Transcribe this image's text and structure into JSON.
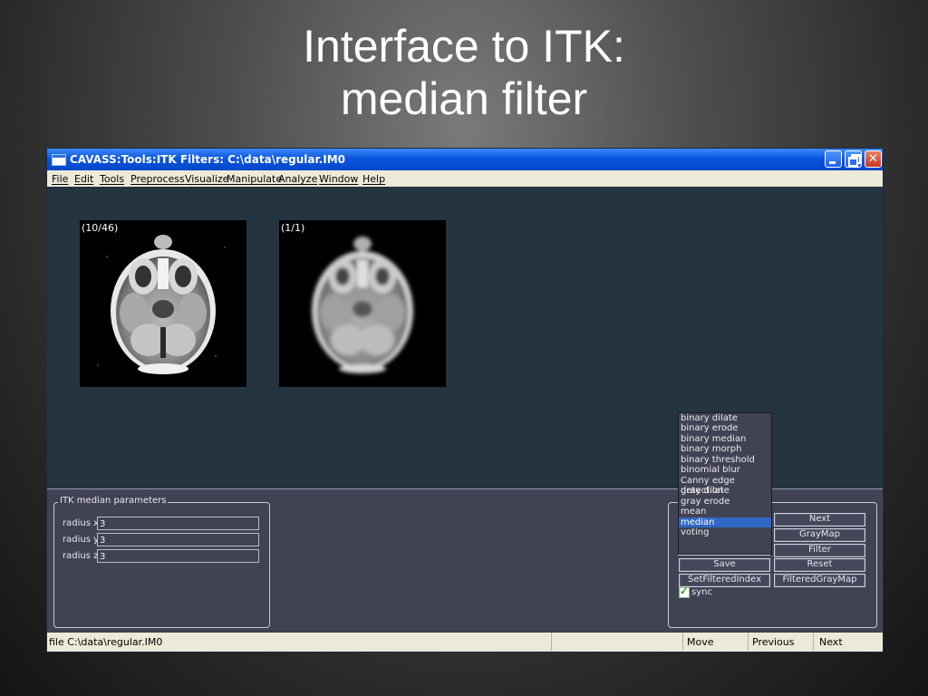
{
  "slide": {
    "title_line1": "Interface to ITK:",
    "title_line2": "median filter"
  },
  "window": {
    "title": "CAVASS:Tools:ITK Filters: C:\\data\\regular.IM0",
    "controls": [
      "minimize",
      "maximize",
      "close"
    ]
  },
  "menu": [
    "File",
    "Edit",
    "Tools",
    "Preprocess",
    "Visualize",
    "Manipulate",
    "Analyze",
    "Window",
    "Help"
  ],
  "images": {
    "left_label": "(10/46)",
    "right_label": "(1/1)"
  },
  "params": {
    "group_title": "ITK median parameters",
    "rows": [
      {
        "label": "radius x",
        "value": "3"
      },
      {
        "label": "radius y",
        "value": "3"
      },
      {
        "label": "radius z",
        "value": "3"
      }
    ]
  },
  "filter_list": {
    "options": [
      "binary dilate",
      "binary erode",
      "binary median",
      "binary morph",
      "binary threshold",
      "binomial blur",
      "Canny edge detection",
      "gray dilate",
      "gray erode",
      "mean",
      "median",
      "voting"
    ],
    "selected": "median"
  },
  "buttons": {
    "next": "Next",
    "graymap": "GrayMap",
    "filter": "Filter",
    "save": "Save",
    "reset": "Reset",
    "set_filtered_index": "SetFilteredIndex",
    "filtered_graymap": "FilteredGrayMap"
  },
  "sync": {
    "label": "sync",
    "checked": true
  },
  "status": {
    "file": "file C:\\data\\regular.IM0",
    "move": "Move",
    "previous": "Previous",
    "next": "Next"
  },
  "colors": {
    "titlebar": "#0a55e0",
    "viewer_bg": "#243441",
    "panel_bg": "#414354",
    "highlight": "#3168c8"
  }
}
